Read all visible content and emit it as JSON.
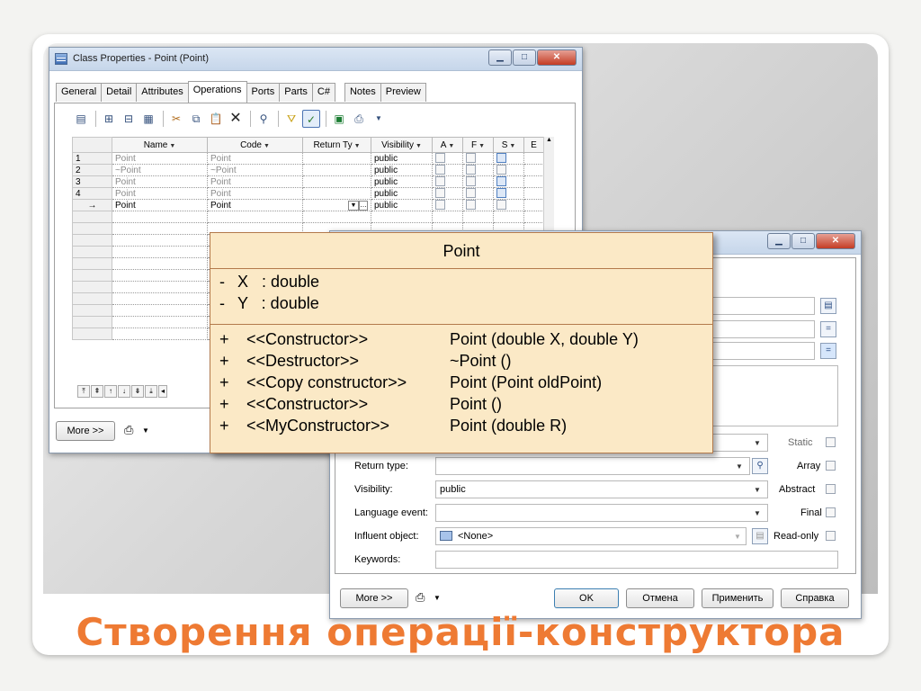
{
  "main_window": {
    "title": "Class Properties - Point (Point)",
    "tabs": [
      {
        "label": "General"
      },
      {
        "label": "Detail"
      },
      {
        "label": "Attributes"
      },
      {
        "label": "Operations"
      },
      {
        "label": "Ports"
      },
      {
        "label": "Parts"
      },
      {
        "label": "C#"
      },
      {
        "label": "Notes"
      },
      {
        "label": "Preview"
      }
    ],
    "toolbar_icons": [
      "properties-icon",
      "add-row-icon",
      "insert-row-icon",
      "add-columns-icon",
      "cut-icon",
      "copy-icon",
      "paste-icon",
      "delete-icon",
      "find-icon",
      "filter-icon",
      "customize-columns-icon",
      "excel-icon",
      "print-icon"
    ],
    "grid": {
      "headers": [
        "Name",
        "Code",
        "Return Ty",
        "Visibility",
        "A",
        "F",
        "S",
        "E"
      ],
      "rows": [
        {
          "num": "1",
          "name": "Point",
          "code": "Point",
          "visibility": "public",
          "s_checked": true
        },
        {
          "num": "2",
          "name": "~Point",
          "code": "~Point",
          "visibility": "public",
          "s_checked": false
        },
        {
          "num": "3",
          "name": "Point",
          "code": "Point",
          "visibility": "public",
          "s_checked": true
        },
        {
          "num": "4",
          "name": "Point",
          "code": "Point",
          "visibility": "public",
          "s_checked": true
        },
        {
          "num": "→",
          "name": "Point",
          "code": "Point",
          "visibility": "public",
          "s_checked": false
        }
      ]
    },
    "more_label": "More >>"
  },
  "operation_window": {
    "fields": {
      "return_type_label": "Return type:",
      "visibility_label": "Visibility:",
      "visibility_value": "public",
      "language_event_label": "Language event:",
      "influent_object_label": "Influent object:",
      "influent_object_value": "<None>",
      "keywords_label": "Keywords:"
    },
    "checks": {
      "static": "Static",
      "array": "Array",
      "abstract": "Abstract",
      "final": "Final",
      "readonly": "Read-only"
    },
    "buttons": {
      "more": "More >>",
      "ok": "OK",
      "cancel": "Отмена",
      "apply": "Применить",
      "help": "Справка"
    }
  },
  "uml": {
    "class_name": "Point",
    "attributes": [
      {
        "vis": "-",
        "text": "X   : double"
      },
      {
        "vis": "-",
        "text": "Y   : double"
      }
    ],
    "operations": [
      {
        "vis": "+",
        "stereo": "<<Constructor>>",
        "sig": "Point (double X, double Y)"
      },
      {
        "vis": "+",
        "stereo": "<<Destructor>>",
        "sig": "~Point ()"
      },
      {
        "vis": "+",
        "stereo": "<<Copy constructor>>",
        "sig": "Point (Point oldPoint)"
      },
      {
        "vis": "+",
        "stereo": "<<Constructor>>",
        "sig": "Point ()"
      },
      {
        "vis": "+",
        "stereo": "<<MyConstructor>>",
        "sig": "Point (double R)"
      }
    ]
  },
  "headline": "Створення операції-конструктора",
  "colors": {
    "headline": "#ee7a33",
    "uml_fill": "#fbe9c6",
    "uml_border": "#b37a4c"
  }
}
